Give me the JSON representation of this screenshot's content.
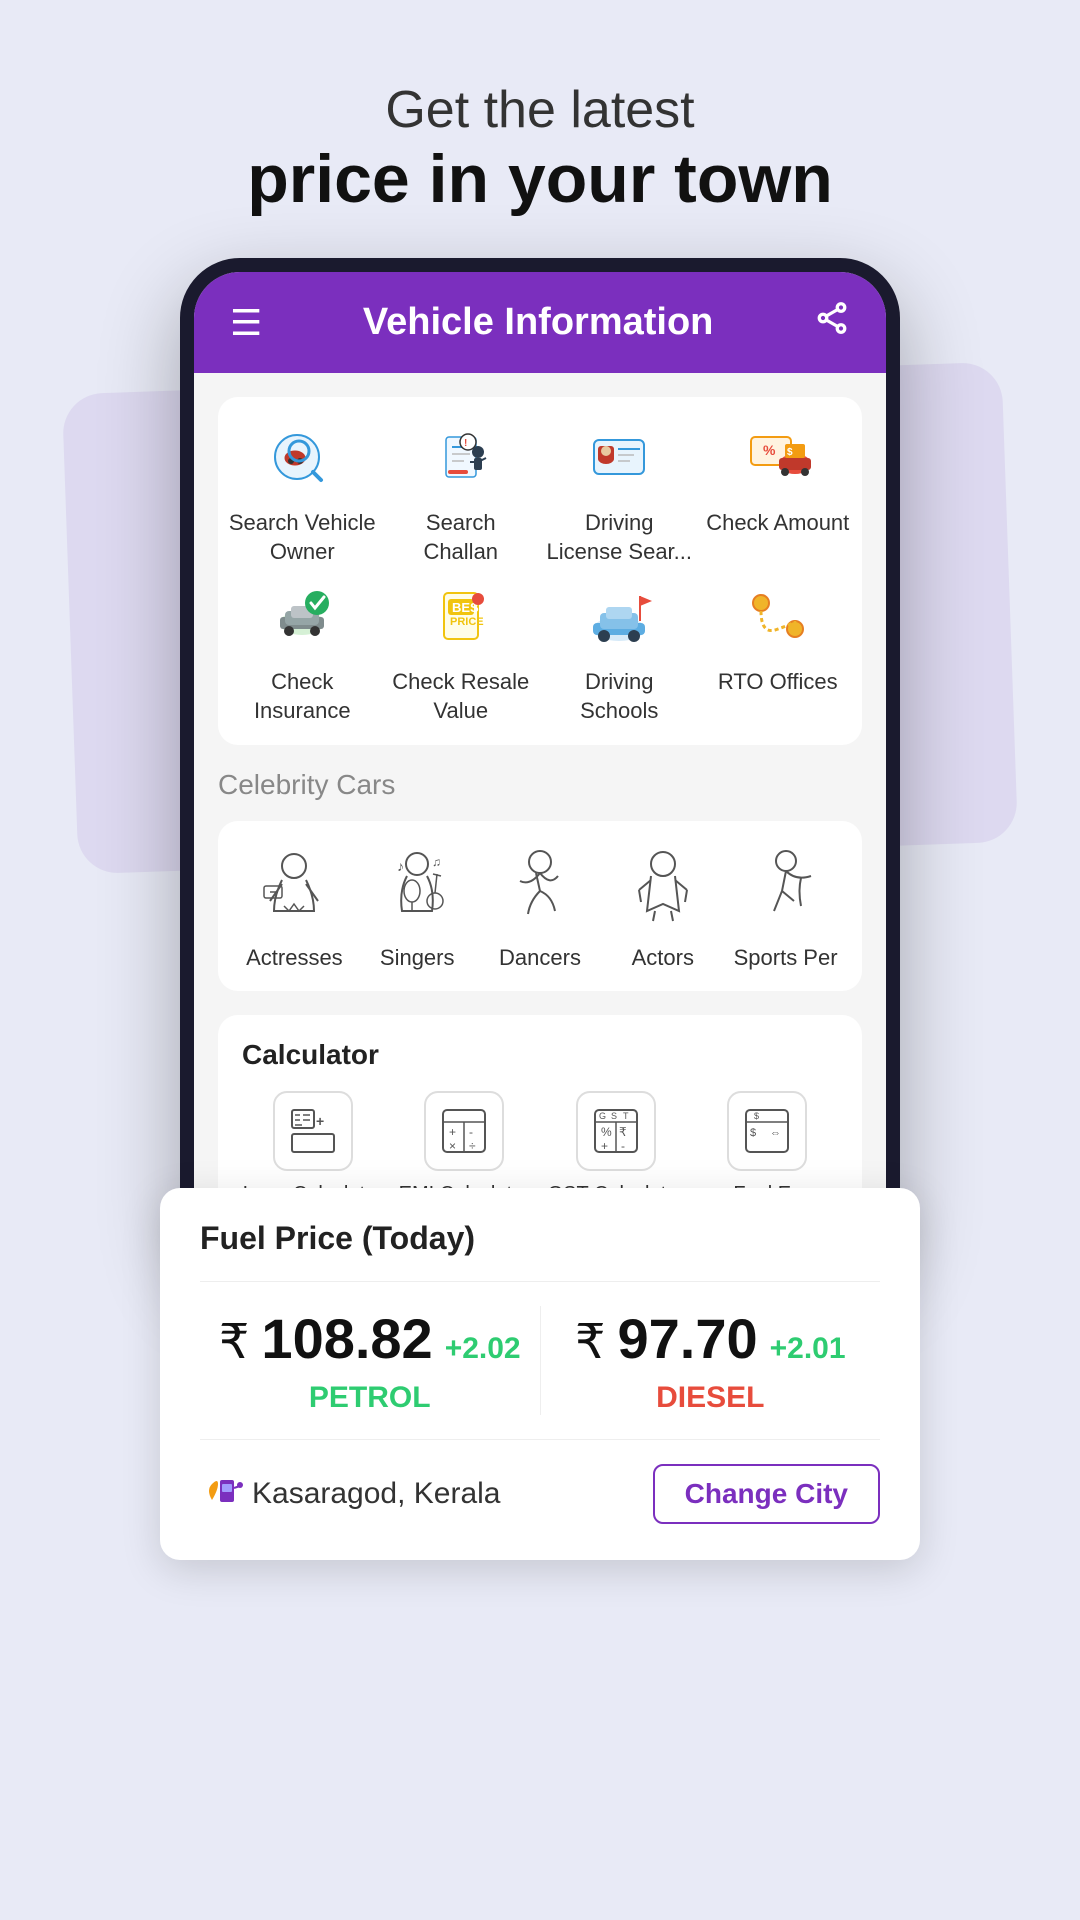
{
  "hero": {
    "subtitle": "Get the latest",
    "title": "price in your town"
  },
  "app": {
    "header_title": "Vehicle Information",
    "menu_icon": "☰",
    "share_icon": "⎋"
  },
  "grid": {
    "row1": [
      {
        "label": "Search Vehicle Owner",
        "icon": "search_vehicle"
      },
      {
        "label": "Search Challan",
        "icon": "search_challan"
      },
      {
        "label": "Driving License Sear...",
        "icon": "driving_license"
      },
      {
        "label": "Check Amount",
        "icon": "check_amount"
      }
    ],
    "row2": [
      {
        "label": "Check Insurance",
        "icon": "check_insurance"
      },
      {
        "label": "Check Resale Value",
        "icon": "resale_value"
      },
      {
        "label": "Driving Schools",
        "icon": "driving_schools"
      },
      {
        "label": "RTO Offices",
        "icon": "rto_offices"
      }
    ]
  },
  "fuel": {
    "title": "Fuel Price (Today)",
    "petrol_price": "108.82",
    "petrol_change": "+2.02",
    "petrol_label": "PETROL",
    "diesel_price": "97.70",
    "diesel_change": "+2.01",
    "diesel_label": "DIESEL",
    "rupee_symbol": "₹",
    "city": "Kasaragod, Kerala",
    "change_city_btn": "Change City"
  },
  "celebrity": {
    "section_title": "Celebrity Cars",
    "items": [
      {
        "label": "Actresses",
        "icon": "actress"
      },
      {
        "label": "Singers",
        "icon": "singer"
      },
      {
        "label": "Dancers",
        "icon": "dancer"
      },
      {
        "label": "Actors",
        "icon": "actor"
      },
      {
        "label": "Sports Per",
        "icon": "sports"
      }
    ]
  },
  "calculator": {
    "title": "Calculator",
    "items": [
      {
        "label": "Loan Calculator",
        "icon": "loan"
      },
      {
        "label": "EMI Calculator",
        "icon": "emi"
      },
      {
        "label": "GST Calculator",
        "icon": "gst"
      },
      {
        "label": "Fuel Ex",
        "icon": "fuel_ex"
      }
    ]
  }
}
